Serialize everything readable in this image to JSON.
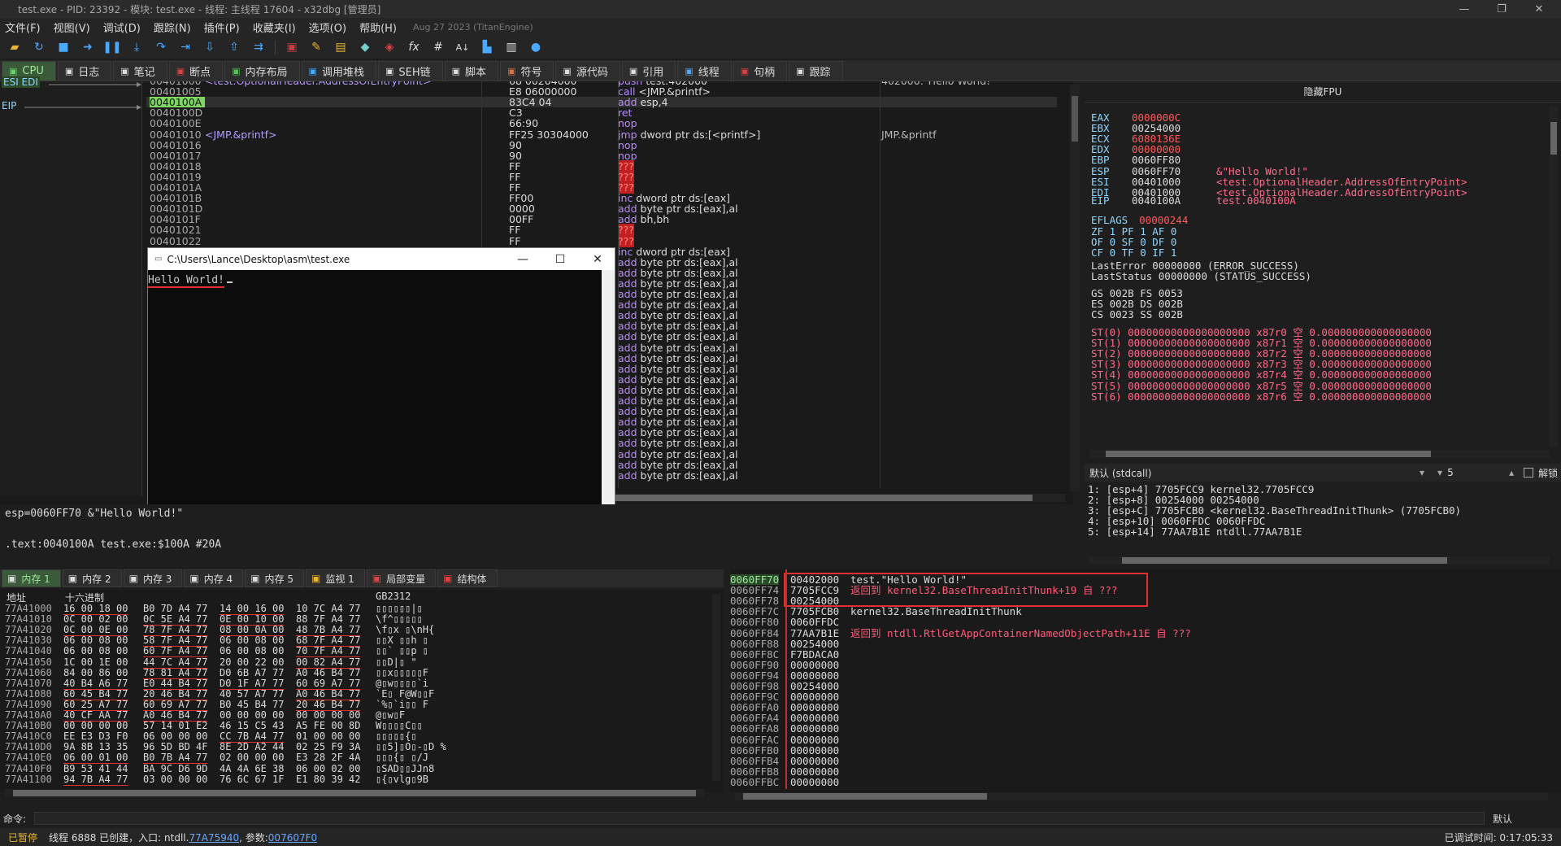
{
  "window": {
    "title": "test.exe - PID: 23392 - 模块: test.exe - 线程: 主线程 17604 - x32dbg [管理员]"
  },
  "menu": [
    "文件(F)",
    "视图(V)",
    "调试(D)",
    "跟踪(N)",
    "插件(P)",
    "收藏夹(I)",
    "选项(O)",
    "帮助(H)"
  ],
  "menu_date": "Aug 27 2023 (TitanEngine)",
  "tabs": [
    {
      "icon": "cpu-icon",
      "label": "CPU",
      "active": true
    },
    {
      "icon": "log-icon",
      "label": "日志"
    },
    {
      "icon": "notes-icon",
      "label": "笔记"
    },
    {
      "icon": "breakpoint-icon",
      "label": "断点"
    },
    {
      "icon": "memory-map-icon",
      "label": "内存布局"
    },
    {
      "icon": "callstack-icon",
      "label": "调用堆栈"
    },
    {
      "icon": "seh-icon",
      "label": "SEH链"
    },
    {
      "icon": "script-icon",
      "label": "脚本"
    },
    {
      "icon": "symbol-icon",
      "label": "符号"
    },
    {
      "icon": "source-icon",
      "label": "源代码"
    },
    {
      "icon": "references-icon",
      "label": "引用"
    },
    {
      "icon": "threads-icon",
      "label": "线程"
    },
    {
      "icon": "handles-icon",
      "label": "句柄"
    },
    {
      "icon": "trace-icon",
      "label": "跟踪"
    }
  ],
  "regmini": {
    "esi_edi": "ESI EDI",
    "eip": "EIP"
  },
  "disasm": [
    {
      "addr": "00401000",
      "label": "<test.OptionalHeader.AddressOfEntryPoint>",
      "bytes": "68 00204000",
      "mn": "push",
      "op": "test.402000",
      "cmt": "402000:\"Hello World!\""
    },
    {
      "addr": "00401005",
      "label": "",
      "bytes": "E8 06000000",
      "mn": "call",
      "op": "<JMP.&printf>",
      "cmt": ""
    },
    {
      "addr": "0040100A",
      "label": "",
      "bytes": "83C4 04",
      "mn": "add",
      "op": "esp,4",
      "cmt": "",
      "eip": true
    },
    {
      "addr": "0040100D",
      "label": "",
      "bytes": "C3",
      "mn": "ret",
      "op": "",
      "cmt": ""
    },
    {
      "addr": "0040100E",
      "label": "",
      "bytes": "66:90",
      "mn": "nop",
      "op": "",
      "cmt": ""
    },
    {
      "addr": "00401010",
      "label": "<JMP.&printf>",
      "bytes": "FF25 30304000",
      "mn": "jmp",
      "op": "dword ptr ds:[<printf>]",
      "cmt": "JMP.&printf"
    },
    {
      "addr": "00401016",
      "label": "",
      "bytes": "90",
      "mn": "nop",
      "op": "",
      "cmt": ""
    },
    {
      "addr": "00401017",
      "label": "",
      "bytes": "90",
      "mn": "nop",
      "op": "",
      "cmt": ""
    },
    {
      "addr": "00401018",
      "label": "",
      "bytes": "FF",
      "mn": "???",
      "op": "",
      "cmt": ""
    },
    {
      "addr": "00401019",
      "label": "",
      "bytes": "FF",
      "mn": "???",
      "op": "",
      "cmt": ""
    },
    {
      "addr": "0040101A",
      "label": "",
      "bytes": "FF",
      "mn": "???",
      "op": "",
      "cmt": ""
    },
    {
      "addr": "0040101B",
      "label": "",
      "bytes": "FF00",
      "mn": "inc",
      "op": "dword ptr ds:[eax]",
      "cmt": ""
    },
    {
      "addr": "0040101D",
      "label": "",
      "bytes": "0000",
      "mn": "add",
      "op": "byte ptr ds:[eax],al",
      "cmt": ""
    },
    {
      "addr": "0040101F",
      "label": "",
      "bytes": "00FF",
      "mn": "add",
      "op": "bh,bh",
      "cmt": ""
    },
    {
      "addr": "00401021",
      "label": "",
      "bytes": "FF",
      "mn": "???",
      "op": "",
      "cmt": ""
    },
    {
      "addr": "00401022",
      "label": "",
      "bytes": "FF",
      "mn": "???",
      "op": "",
      "cmt": ""
    },
    {
      "addr": "",
      "label": "",
      "bytes": "",
      "mn": "inc",
      "op": "dword ptr ds:[eax]",
      "cmt": ""
    }
  ],
  "disasm_fill": {
    "mn": "add",
    "op": "byte ptr ds:[eax],al"
  },
  "console": {
    "title": "C:\\Users\\Lance\\Desktop\\asm\\test.exe",
    "text": "Hello World!"
  },
  "regs": {
    "header": "隐藏FPU",
    "gpr": [
      {
        "n": "EAX",
        "v": "0000000C",
        "c": "",
        "chg": true
      },
      {
        "n": "EBX",
        "v": "00254000",
        "c": ""
      },
      {
        "n": "ECX",
        "v": "6080136E",
        "c": "",
        "chg": true
      },
      {
        "n": "EDX",
        "v": "00000000",
        "c": "",
        "chg": true
      },
      {
        "n": "EBP",
        "v": "0060FF80",
        "c": ""
      },
      {
        "n": "ESP",
        "v": "0060FF70",
        "c": "&\"Hello World!\""
      },
      {
        "n": "ESI",
        "v": "00401000",
        "c": "<test.OptionalHeader.AddressOfEntryPoint>"
      },
      {
        "n": "EDI",
        "v": "00401000",
        "c": "<test.OptionalHeader.AddressOfEntryPoint>"
      }
    ],
    "eip": {
      "n": "EIP",
      "v": "0040100A",
      "c": "test.0040100A"
    },
    "eflags": {
      "n": "EFLAGS",
      "v": "00000244"
    },
    "flags1": "ZF 1  PF 1  AF 0",
    "flags2": "OF 0  SF 0  DF 0",
    "flags3": "CF 0  TF 0  IF 1",
    "lasterror": "LastError  00000000 (ERROR_SUCCESS)",
    "laststatus": "LastStatus 00000000 (STATUS_SUCCESS)",
    "seg1": "GS 002B  FS 0053",
    "seg2": "ES 002B  DS 002B",
    "seg3": "CS 0023  SS 002B",
    "st": [
      "ST(0) 00000000000000000000 x87r0 空 0.000000000000000000",
      "ST(1) 00000000000000000000 x87r1 空 0.000000000000000000",
      "ST(2) 00000000000000000000 x87r2 空 0.000000000000000000",
      "ST(3) 00000000000000000000 x87r3 空 0.000000000000000000",
      "ST(4) 00000000000000000000 x87r4 空 0.000000000000000000",
      "ST(5) 00000000000000000000 x87r5 空 0.000000000000000000",
      "ST(6) 00000000000000000000 x87r6 空 0.000000000000000000"
    ]
  },
  "callconv": {
    "label": "默认 (stdcall)",
    "count": "5",
    "unlock": "解锁"
  },
  "stackargs": [
    "1: [esp+4] 7705FCC9 kernel32.7705FCC9",
    "2: [esp+8] 00254000 00254000",
    "3: [esp+C] 7705FCB0 <kernel32.BaseThreadInitThunk> (7705FCB0)",
    "4: [esp+10] 0060FFDC 0060FFDC",
    "5: [esp+14] 77AA7B1E ntdll.77AA7B1E"
  ],
  "info": {
    "line1": "esp=0060FF70 &\"Hello World!\"",
    "line2": ".text:0040100A test.exe:$100A #20A"
  },
  "memtabs": [
    {
      "icon": "memory-icon",
      "label": "内存 1",
      "active": true
    },
    {
      "icon": "memory-icon",
      "label": "内存 2"
    },
    {
      "icon": "memory-icon",
      "label": "内存 3"
    },
    {
      "icon": "memory-icon",
      "label": "内存 4"
    },
    {
      "icon": "memory-icon",
      "label": "内存 5"
    },
    {
      "icon": "watch-icon",
      "label": "监视 1"
    },
    {
      "icon": "locals-icon",
      "label": "局部变量"
    },
    {
      "icon": "struct-icon",
      "label": "结构体"
    }
  ],
  "dump_headers": {
    "addr": "地址",
    "hex": "十六进制",
    "text": "GB2312"
  },
  "dump": [
    {
      "a": "77A41000",
      "h": [
        "16 00 18 00",
        "B0 7D A4 77",
        "14 00 16 00",
        "10 7C A4 77"
      ],
      "t": "  ▯▯▯▯▯▯|▯"
    },
    {
      "a": "77A41010",
      "h": [
        "0C 00 02 00",
        "0C 5E A4 77",
        "0E 00 10 00",
        "88 7F A4 77"
      ],
      "t": "  \\f^▯▯▯▯▯"
    },
    {
      "a": "77A41020",
      "h": [
        "0C 00 0E 00",
        "78 7F A4 77",
        "08 00 0A 00",
        "48 7B A4 77"
      ],
      "t": "  \\f▯x ▯\\nH{"
    },
    {
      "a": "77A41030",
      "h": [
        "06 00 08 00",
        "58 7F A4 77",
        "06 00 08 00",
        "68 7F A4 77"
      ],
      "t": "  ▯▯X  ▯▯h ▯"
    },
    {
      "a": "77A41040",
      "h": [
        "06 00 08 00",
        "60 7F A4 77",
        "06 00 08 00",
        "70 7F A4 77"
      ],
      "t": "  ▯▯`  ▯▯p ▯"
    },
    {
      "a": "77A41050",
      "h": [
        "1C 00 1E 00",
        "44 7C A4 77",
        "20 00 22 00",
        "00 82 A4 77"
      ],
      "t": "  ▯▯D|▯  \""
    },
    {
      "a": "77A41060",
      "h": [
        "84 00 86 00",
        "78 81 A4 77",
        "D0 6B A7 77",
        "A0 46 B4 77"
      ],
      "t": "  ▯▯x▯▯▯▯▯F"
    },
    {
      "a": "77A41070",
      "h": [
        "40 B4 A6 77",
        "E0 44 B4 77",
        "D0 1F A7 77",
        "60 69 A7 77"
      ],
      "t": "  @▯w▯▯▯▯`i"
    },
    {
      "a": "77A41080",
      "h": [
        "60 45 B4 77",
        "20 46 B4 77",
        "40 57 A7 77",
        "A0 46 B4 77"
      ],
      "t": "  `E▯ F@W▯▯F"
    },
    {
      "a": "77A41090",
      "h": [
        "60 25 A7 77",
        "60 69 A7 77",
        "B0 45 B4 77",
        "20 46 B4 77"
      ],
      "t": "  `%▯`i▯▯ F"
    },
    {
      "a": "77A410A0",
      "h": [
        "40 CF AA 77",
        "A0 46 B4 77",
        "00 00 00 00",
        "00 00 00 00"
      ],
      "t": "  @▯w▯F"
    },
    {
      "a": "77A410B0",
      "h": [
        "00 00 00 00",
        "57 14 01 E2",
        "46 15 C5 43",
        "A5 FE 00 8D"
      ],
      "t": "  W▯▯▯▯C▯▯"
    },
    {
      "a": "77A410C0",
      "h": [
        "EE E3 D3 F0",
        "06 00 00 00",
        "CC 7B A4 77",
        "01 00 00 00"
      ],
      "t": "  ▯▯▯▯▯{▯"
    },
    {
      "a": "77A410D0",
      "h": [
        "9A 8B 13 35",
        "96 5D BD 4F",
        "8E 2D A2 44",
        "02 25 F9 3A"
      ],
      "t": "  ▯▯5]▯O▯-▯D %"
    },
    {
      "a": "77A410E0",
      "h": [
        "06 00 01 00",
        "B0 7B A4 77",
        "02 00 00 00",
        "E3 28 2F 4A"
      ],
      "t": "  ▯▯▯{▯ ▯/J"
    },
    {
      "a": "77A410F0",
      "h": [
        "B9 53 41 44",
        "BA 9C D6 9D",
        "4A 4A 6E 38",
        "06 00 02 00"
      ],
      "t": "  ▯SAD▯▯JJn8"
    },
    {
      "a": "77A41100",
      "h": [
        "94 7B A4 77",
        "03 00 00 00",
        "76 6C 67 1F",
        "E1 80 39 42"
      ],
      "t": "  ▯{▯vlg▯9B"
    }
  ],
  "stack": [
    {
      "a": "0060FF70",
      "v": "00402000",
      "c": "test.\"Hello World!\"",
      "top": true
    },
    {
      "a": "0060FF74",
      "v": "7705FCC9",
      "c": "返回到 kernel32.BaseThreadInitThunk+19 自 ???",
      "red": true
    },
    {
      "a": "0060FF78",
      "v": "00254000",
      "c": ""
    },
    {
      "a": "0060FF7C",
      "v": "7705FCB0",
      "c": "kernel32.BaseThreadInitThunk"
    },
    {
      "a": "0060FF80",
      "v": "0060FFDC",
      "c": ""
    },
    {
      "a": "0060FF84",
      "v": "77AA7B1E",
      "c": "返回到 ntdll.RtlGetAppContainerNamedObjectPath+11E 自 ???",
      "red": true
    },
    {
      "a": "0060FF88",
      "v": "00254000",
      "c": ""
    },
    {
      "a": "0060FF8C",
      "v": "F7BDACA0",
      "c": ""
    },
    {
      "a": "0060FF90",
      "v": "00000000",
      "c": ""
    },
    {
      "a": "0060FF94",
      "v": "00000000",
      "c": ""
    },
    {
      "a": "0060FF98",
      "v": "00254000",
      "c": ""
    },
    {
      "a": "0060FF9C",
      "v": "00000000",
      "c": ""
    },
    {
      "a": "0060FFA0",
      "v": "00000000",
      "c": ""
    },
    {
      "a": "0060FFA4",
      "v": "00000000",
      "c": ""
    },
    {
      "a": "0060FFA8",
      "v": "00000000",
      "c": ""
    },
    {
      "a": "0060FFAC",
      "v": "00000000",
      "c": ""
    },
    {
      "a": "0060FFB0",
      "v": "00000000",
      "c": ""
    },
    {
      "a": "0060FFB4",
      "v": "00000000",
      "c": ""
    },
    {
      "a": "0060FFB8",
      "v": "00000000",
      "c": ""
    },
    {
      "a": "0060FFBC",
      "v": "00000000",
      "c": ""
    }
  ],
  "cmd": {
    "label": "命令:",
    "default": "默认"
  },
  "status": {
    "state": "已暂停",
    "text": "线程  6888  已创建，入口: ntdll.",
    "entry": "77A75940",
    "args_label": ", 参数:",
    "args": "007607F0",
    "time": "已调试时间:  0:17:05:33"
  },
  "colors": {
    "accent": "#7fd660",
    "red": "#e03030",
    "mnemonic": "#b88cff"
  }
}
